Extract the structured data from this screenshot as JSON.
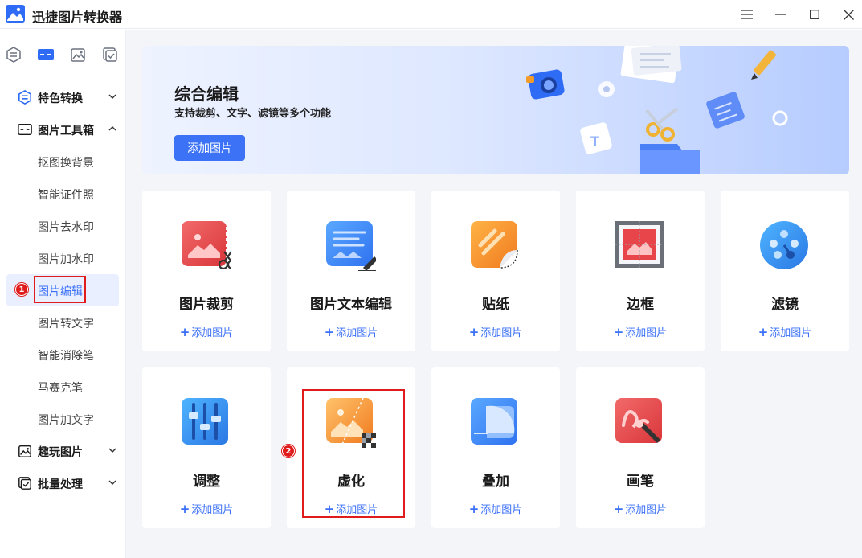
{
  "app": {
    "title": "迅捷图片转换器"
  },
  "sidebar": {
    "groups": [
      {
        "label": "特色转换"
      },
      {
        "label": "图片工具箱"
      },
      {
        "label": "趣玩图片"
      },
      {
        "label": "批量处理"
      }
    ],
    "toolbox_items": [
      {
        "label": "抠图换背景"
      },
      {
        "label": "智能证件照"
      },
      {
        "label": "图片去水印"
      },
      {
        "label": "图片加水印"
      },
      {
        "label": "图片编辑"
      },
      {
        "label": "图片转文字"
      },
      {
        "label": "智能消除笔"
      },
      {
        "label": "马赛克笔"
      },
      {
        "label": "图片加文字"
      }
    ],
    "active_item": "图片编辑"
  },
  "banner": {
    "title": "综合编辑",
    "subtitle": "支持裁剪、文字、滤镜等多个功能",
    "button": "添加图片"
  },
  "cards": [
    {
      "name": "图片裁剪",
      "add": "添加图片",
      "icon": "crop-icon"
    },
    {
      "name": "图片文本编辑",
      "add": "添加图片",
      "icon": "text-edit-icon"
    },
    {
      "name": "贴纸",
      "add": "添加图片",
      "icon": "sticker-icon"
    },
    {
      "name": "边框",
      "add": "添加图片",
      "icon": "frame-icon"
    },
    {
      "name": "滤镜",
      "add": "添加图片",
      "icon": "filter-icon"
    },
    {
      "name": "调整",
      "add": "添加图片",
      "icon": "adjust-icon"
    },
    {
      "name": "虚化",
      "add": "添加图片",
      "icon": "blur-icon"
    },
    {
      "name": "叠加",
      "add": "添加图片",
      "icon": "overlay-icon"
    },
    {
      "name": "画笔",
      "add": "添加图片",
      "icon": "brush-icon"
    }
  ],
  "annotations": [
    {
      "number": "1"
    },
    {
      "number": "2"
    }
  ],
  "colors": {
    "accent": "#3a6ff7",
    "annotation": "#e01b1b"
  }
}
